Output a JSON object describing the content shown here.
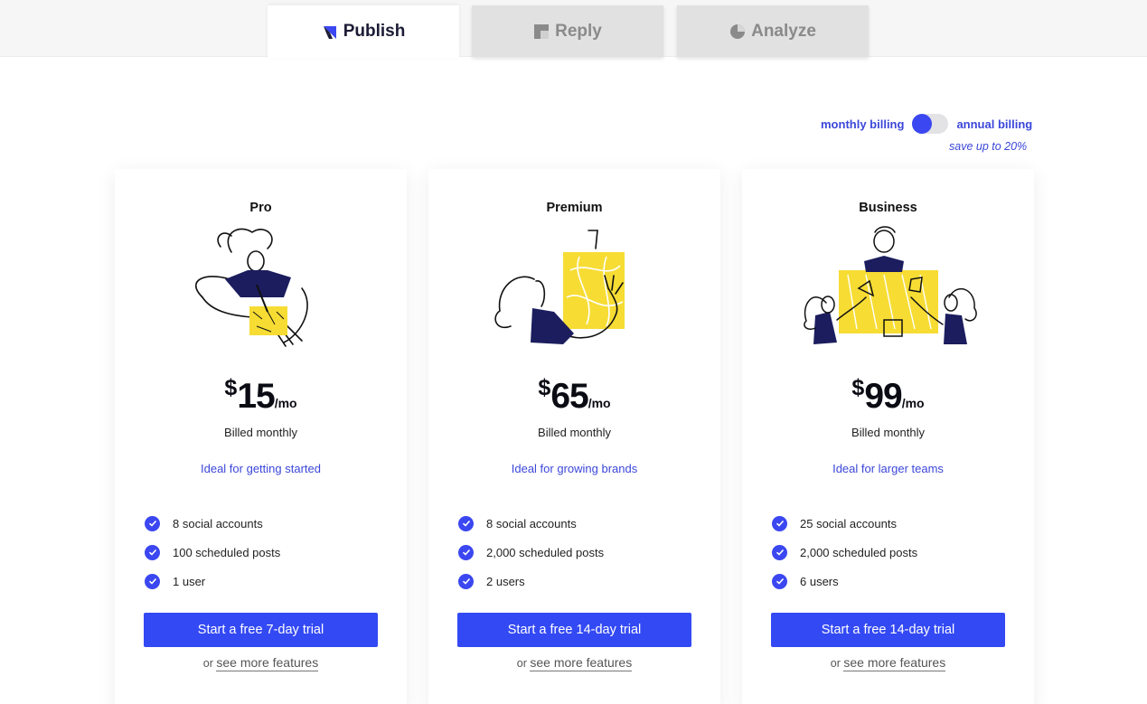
{
  "tabs": [
    {
      "label": "Publish",
      "icon": "publish-icon",
      "active": true
    },
    {
      "label": "Reply",
      "icon": "reply-icon",
      "active": false
    },
    {
      "label": "Analyze",
      "icon": "analyze-icon",
      "active": false
    }
  ],
  "billing": {
    "monthly_label": "monthly billing",
    "annual_label": "annual billing",
    "save_note": "save up to 20%",
    "selected": "monthly"
  },
  "colors": {
    "accent": "#3349f4",
    "link_blue": "#3b47d9",
    "illustration_yellow": "#f7dc34",
    "illustration_navy": "#1b1d5e"
  },
  "plans": [
    {
      "name": "Pro",
      "currency": "$",
      "price": "15",
      "period": "/mo",
      "billed": "Billed monthly",
      "ideal": "Ideal for getting started",
      "features": [
        "8 social accounts",
        "100 scheduled posts",
        "1 user"
      ],
      "cta": "Start a free 7-day trial",
      "more_prefix": "or",
      "more_link": "see more features"
    },
    {
      "name": "Premium",
      "currency": "$",
      "price": "65",
      "period": "/mo",
      "billed": "Billed monthly",
      "ideal": "Ideal for growing brands",
      "features": [
        "8 social accounts",
        "2,000 scheduled posts",
        "2 users"
      ],
      "cta": "Start a free 14-day trial",
      "more_prefix": "or",
      "more_link": "see more features"
    },
    {
      "name": "Business",
      "currency": "$",
      "price": "99",
      "period": "/mo",
      "billed": "Billed monthly",
      "ideal": "Ideal for larger teams",
      "features": [
        "25 social accounts",
        "2,000 scheduled posts",
        "6 users"
      ],
      "cta": "Start a free 14-day trial",
      "more_prefix": "or",
      "more_link": "see more features"
    }
  ]
}
